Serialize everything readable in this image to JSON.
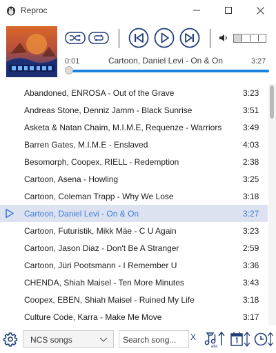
{
  "window": {
    "title": "Reproc"
  },
  "player": {
    "current_time": "0:01",
    "total_time": "3:27",
    "now_playing": "Cartoon, Daniel Levi - On & On",
    "progress": 0.005,
    "volume": 0.25,
    "accent": "#1a83e0"
  },
  "icons": {
    "app": "penguin-icon",
    "shuffle": "shuffle-icon",
    "repeat": "repeat-icon",
    "previous": "skip-previous-icon",
    "play": "play-icon",
    "next": "skip-next-icon",
    "volume": "speaker-icon",
    "settings": "gear-icon",
    "sort_alpha": "sort-alphabetical-icon",
    "sort_date": "sort-date-icon",
    "sort_duration": "sort-duration-icon"
  },
  "playlist": {
    "active_index": 7,
    "active_color": "#3b7bd6",
    "tracks": [
      {
        "title": "Abandoned, ENROSA - Out of the Grave",
        "duration": "3:23"
      },
      {
        "title": "Andreas Stone, Denniz Jamm - Black Sunrise",
        "duration": "3:51"
      },
      {
        "title": "Asketa & Natan Chaim, M.I.M.E, Requenze - Warriors",
        "duration": "3:49"
      },
      {
        "title": "Barren Gates, M.I.M.E - Enslaved",
        "duration": "4:03"
      },
      {
        "title": "Besomorph, Coopex, RIELL - Redemption",
        "duration": "2:38"
      },
      {
        "title": "Cartoon, Asena - Howling",
        "duration": "3:25"
      },
      {
        "title": "Cartoon, Coleman Trapp - Why We Lose",
        "duration": "3:18"
      },
      {
        "title": "Cartoon, Daniel Levi - On & On",
        "duration": "3:27"
      },
      {
        "title": "Cartoon, Futuristik, Mikk Mäe - C U Again",
        "duration": "3:23"
      },
      {
        "title": "Cartoon, Jason Diaz - Don't Be A Stranger",
        "duration": "2:59"
      },
      {
        "title": "Cartoon, Jüri Pootsmann - I Remember U",
        "duration": "3:36"
      },
      {
        "title": "CHENDA, Shiah Maisel - Ten More Minutes",
        "duration": "3:43"
      },
      {
        "title": "Coopex, EBEN, Shiah Maisel - Ruined My Life",
        "duration": "3:18"
      },
      {
        "title": "Culture Code, Karra - Make Me Move",
        "duration": "3:17"
      }
    ]
  },
  "footer": {
    "playlist_selected": "NCS songs",
    "search_placeholder": "Search song...",
    "clear_label": "X"
  }
}
